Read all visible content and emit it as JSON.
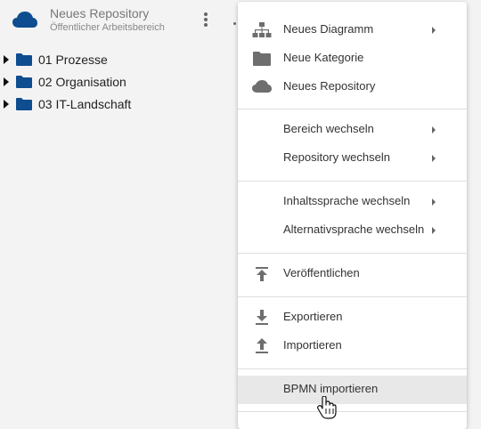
{
  "repository": {
    "title": "Neues Repository",
    "subtitle": "Öffentlicher Arbeitsbereich",
    "icon": "cloud-icon",
    "icon_color": "#0e4d8f"
  },
  "tree": {
    "items": [
      {
        "label": "01 Prozesse"
      },
      {
        "label": "02 Organisation"
      },
      {
        "label": "03 IT-Landschaft"
      }
    ],
    "folder_color": "#0e4d8f"
  },
  "menu": {
    "items": [
      {
        "label": "Neues Diagramm",
        "icon": "sitemap-icon",
        "submenu": true
      },
      {
        "label": "Neue Kategorie",
        "icon": "folder-icon",
        "submenu": false
      },
      {
        "label": "Neues Repository",
        "icon": "cloud-icon",
        "submenu": false
      },
      {
        "label": "Bereich wechseln",
        "submenu": true
      },
      {
        "label": "Repository wechseln",
        "submenu": true
      },
      {
        "label": "Inhaltssprache wechseln",
        "submenu": true
      },
      {
        "label": "Alternativsprache wechseln",
        "submenu": true
      },
      {
        "label": "Veröffentlichen",
        "icon": "publish-icon",
        "submenu": false
      },
      {
        "label": "Exportieren",
        "icon": "download-icon",
        "submenu": false
      },
      {
        "label": "Importieren",
        "icon": "upload-icon",
        "submenu": false
      },
      {
        "label": "BPMN importieren",
        "submenu": false,
        "hovered": true
      }
    ],
    "icon_color": "#6e6e6e"
  }
}
